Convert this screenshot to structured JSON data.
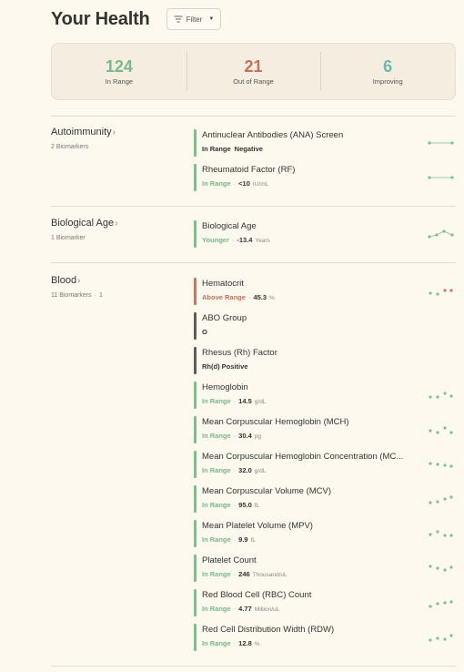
{
  "header": {
    "title": "Your Health",
    "filter_label": "Filter"
  },
  "summary": [
    {
      "value": "124",
      "label": "In Range"
    },
    {
      "value": "21",
      "label": "Out of Range"
    },
    {
      "value": "6",
      "label": "Improving"
    }
  ],
  "categories": {
    "autoimmunity": {
      "name": "Autoimmunity",
      "count": "2 Biomarkers",
      "markers": [
        {
          "name": "Antinuclear Antibodies (ANA) Screen",
          "status": "In Range",
          "value": "Negative",
          "unit": ""
        },
        {
          "name": "Rheumatoid Factor (RF)",
          "status": "In Range",
          "value": "<10",
          "unit": "IU/mL"
        }
      ]
    },
    "biological_age": {
      "name": "Biological Age",
      "count": "1 Biomarker",
      "markers": [
        {
          "name": "Biological Age",
          "status": "Younger",
          "value": "-13.4",
          "unit": "Years"
        }
      ]
    },
    "blood": {
      "name": "Blood",
      "count": "11 Biomarkers",
      "out_count": "1",
      "markers": [
        {
          "name": "Hematocrit",
          "status": "Above Range",
          "value": "45.3",
          "unit": "%"
        },
        {
          "name": "ABO Group",
          "status": "",
          "value": "O",
          "unit": ""
        },
        {
          "name": "Rhesus (Rh) Factor",
          "status": "",
          "value": "Rh(d) Positive",
          "unit": ""
        },
        {
          "name": "Hemoglobin",
          "status": "In Range",
          "value": "14.5",
          "unit": "g/dL"
        },
        {
          "name": "Mean Corpuscular Hemoglobin (MCH)",
          "status": "In Range",
          "value": "30.4",
          "unit": "pg"
        },
        {
          "name": "Mean Corpuscular Hemoglobin Concentration (MC...",
          "status": "In Range",
          "value": "32.0",
          "unit": "g/dL"
        },
        {
          "name": "Mean Corpuscular Volume (MCV)",
          "status": "In Range",
          "value": "95.0",
          "unit": "fL"
        },
        {
          "name": "Mean Platelet Volume (MPV)",
          "status": "In Range",
          "value": "9.9",
          "unit": "fL"
        },
        {
          "name": "Platelet Count",
          "status": "In Range",
          "value": "246",
          "unit": "Thousand/uL"
        },
        {
          "name": "Red Blood Cell (RBC) Count",
          "status": "In Range",
          "value": "4.77",
          "unit": "Million/uL"
        },
        {
          "name": "Red Cell Distribution Width (RDW)",
          "status": "In Range",
          "value": "12.8",
          "unit": "%"
        }
      ]
    }
  },
  "colors": {
    "in_range": "#7cc08d",
    "out_of_range": "#c9775f",
    "improving": "#6bb8b0",
    "neutral": "#5c5c5a"
  },
  "icons": {
    "filter": "filter-lines-icon",
    "chevron": "chevron-right-icon",
    "dropdown": "caret-down-icon",
    "trend": "sparkline-icon"
  }
}
